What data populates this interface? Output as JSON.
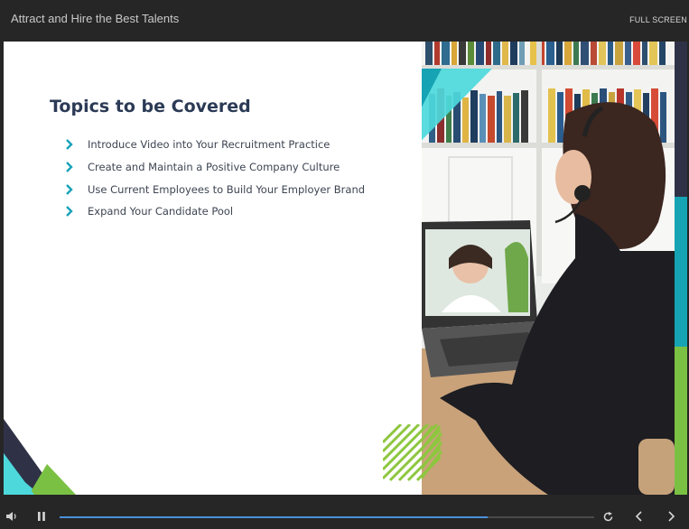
{
  "header": {
    "course_title": "Attract and Hire the Best Talents",
    "fullscreen_label": "FULL SCREEN"
  },
  "slide": {
    "title": "Topics to be Covered",
    "topics": [
      "Introduce Video into Your Recruitment Practice",
      "Create and Maintain a Positive Company Culture",
      "Use Current Employees to Build Your Employer Brand",
      "Expand Your Candidate Pool"
    ],
    "colors": {
      "title": "#2b3a55",
      "chevron": "#17a2b8",
      "teal": "#4dd9dc",
      "dark_teal": "#16a3b4",
      "green": "#7ac143",
      "navy": "#2f3247"
    }
  },
  "player": {
    "icons": [
      "volume-icon",
      "pause-icon",
      "replay-icon",
      "previous-icon",
      "next-icon"
    ],
    "progress": 0.8
  }
}
